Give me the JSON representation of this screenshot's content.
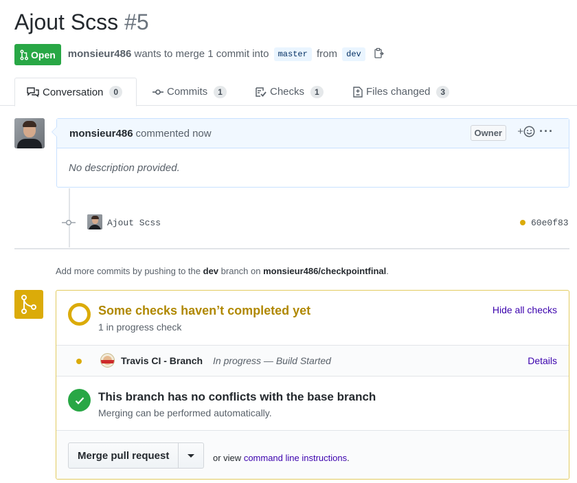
{
  "pr": {
    "title": "Ajout Scss",
    "number": "#5",
    "state": "Open",
    "author": "monsieur486",
    "merge_text_1": "wants to merge 1 commit into",
    "base_branch": "master",
    "from_text": "from",
    "head_branch": "dev"
  },
  "tabs": [
    {
      "label": "Conversation",
      "count": "0"
    },
    {
      "label": "Commits",
      "count": "1"
    },
    {
      "label": "Checks",
      "count": "1"
    },
    {
      "label": "Files changed",
      "count": "3"
    }
  ],
  "comment": {
    "author": "monsieur486",
    "time": "commented now",
    "role_label": "Owner",
    "react_plus": "+",
    "more": "···",
    "body": "No description provided."
  },
  "commit": {
    "message": "Ajout Scss",
    "sha": "60e0f83"
  },
  "hint": {
    "prefix": "Add more commits by pushing to the",
    "branch": "dev",
    "middle": "branch on",
    "repo": "monsieur486/checkpointfinal",
    "suffix": "."
  },
  "checks": {
    "title": "Some checks haven’t completed yet",
    "subtitle": "1 in progress check",
    "toggle_label": "Hide all checks",
    "items": [
      {
        "name": "Travis CI - Branch",
        "description": "In progress — Build Started",
        "link": "Details"
      }
    ]
  },
  "conflicts": {
    "title": "This branch has no conflicts with the base branch",
    "subtitle": "Merging can be performed automatically."
  },
  "merge": {
    "button_label": "Merge pull request",
    "or_view": "or view",
    "cli_link": "command line instructions",
    "period": "."
  },
  "colors": {
    "open_green": "#28a745",
    "pending_yellow": "#dbab09",
    "pending_text": "#b08800",
    "link": "#3a00ad",
    "comment_border": "#c8e1ff"
  }
}
